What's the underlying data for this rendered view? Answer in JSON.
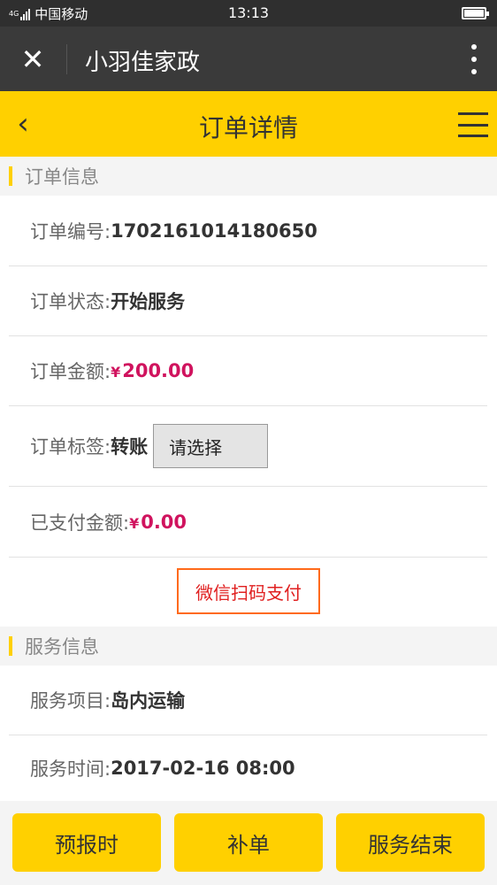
{
  "status_bar": {
    "network": "4G",
    "carrier": "中国移动",
    "time": "13:13"
  },
  "app_bar": {
    "title": "小羽佳家政",
    "close_icon": "close-icon",
    "more_icon": "more-vertical-icon"
  },
  "header": {
    "title": "订单详情",
    "back_icon": "chevron-left-icon",
    "menu_icon": "hamburger-menu-icon",
    "accent_color": "#ffd000"
  },
  "order_section": {
    "title": "订单信息",
    "order_no_label": "订单编号:",
    "order_no": "1702161014180650",
    "status_label": "订单状态:",
    "status": "开始服务",
    "amount_label": "订单金额:",
    "amount_currency": "¥",
    "amount": "200.00",
    "tag_label": "订单标签:",
    "tag_value": "转账",
    "tag_select": "请选择",
    "paid_label": "已支付金额:",
    "paid_currency": "¥",
    "paid": "0.00",
    "pay_button": "微信扫码支付",
    "money_color": "#d0135e"
  },
  "service_section": {
    "title": "服务信息",
    "item_label": "服务项目:",
    "item": "岛内运输",
    "time_label": "服务时间:",
    "time": "2017-02-16 08:00"
  },
  "bottom_actions": {
    "forecast": "预报时",
    "supplement": "补单",
    "finish": "服务结束"
  }
}
